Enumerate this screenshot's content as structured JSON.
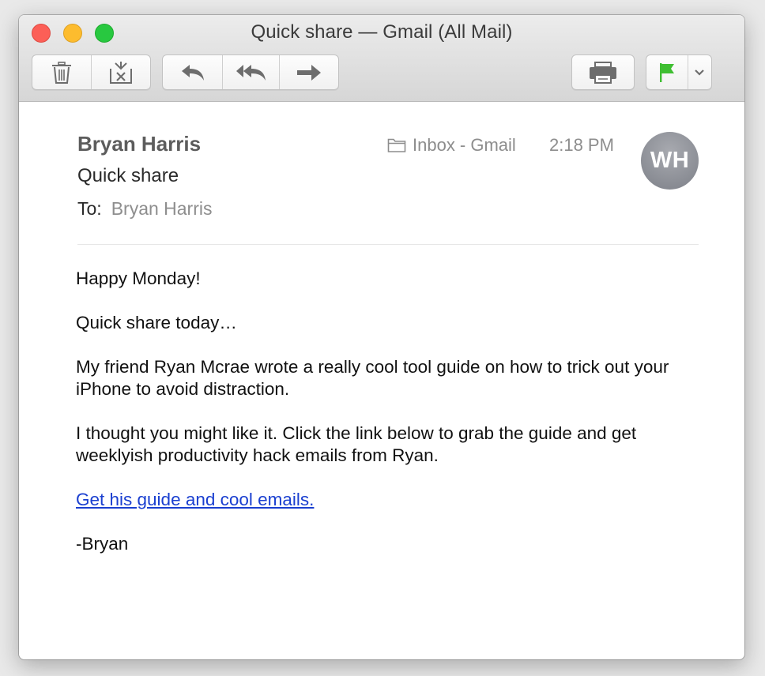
{
  "window": {
    "title": "Quick share — Gmail (All Mail)"
  },
  "toolbar": {
    "buttons": [
      {
        "icon": "trash-icon"
      },
      {
        "icon": "junk-icon"
      },
      {
        "icon": "reply-icon"
      },
      {
        "icon": "reply-all-icon"
      },
      {
        "icon": "forward-icon"
      },
      {
        "icon": "print-icon"
      },
      {
        "icon": "flag-icon"
      },
      {
        "icon": "chevron-down-icon"
      }
    ],
    "flag_color": "#3fbf32"
  },
  "header": {
    "sender": "Bryan Harris",
    "subject": "Quick share",
    "to_label": "To:",
    "to_value": "Bryan Harris",
    "mailbox": "Inbox - Gmail",
    "time": "2:18 PM",
    "avatar_initials": "WH"
  },
  "message": {
    "greeting": "Happy Monday!",
    "line1": "Quick share today…",
    "paragraph1": "My friend Ryan Mcrae wrote a really cool tool guide on how to trick out your iPhone to avoid distraction.",
    "paragraph2": "I thought you might like it. Click the link below to grab the guide and get weeklyish productivity hack emails from Ryan.",
    "link_text": "Get his guide and cool emails.",
    "signature": "-Bryan"
  }
}
